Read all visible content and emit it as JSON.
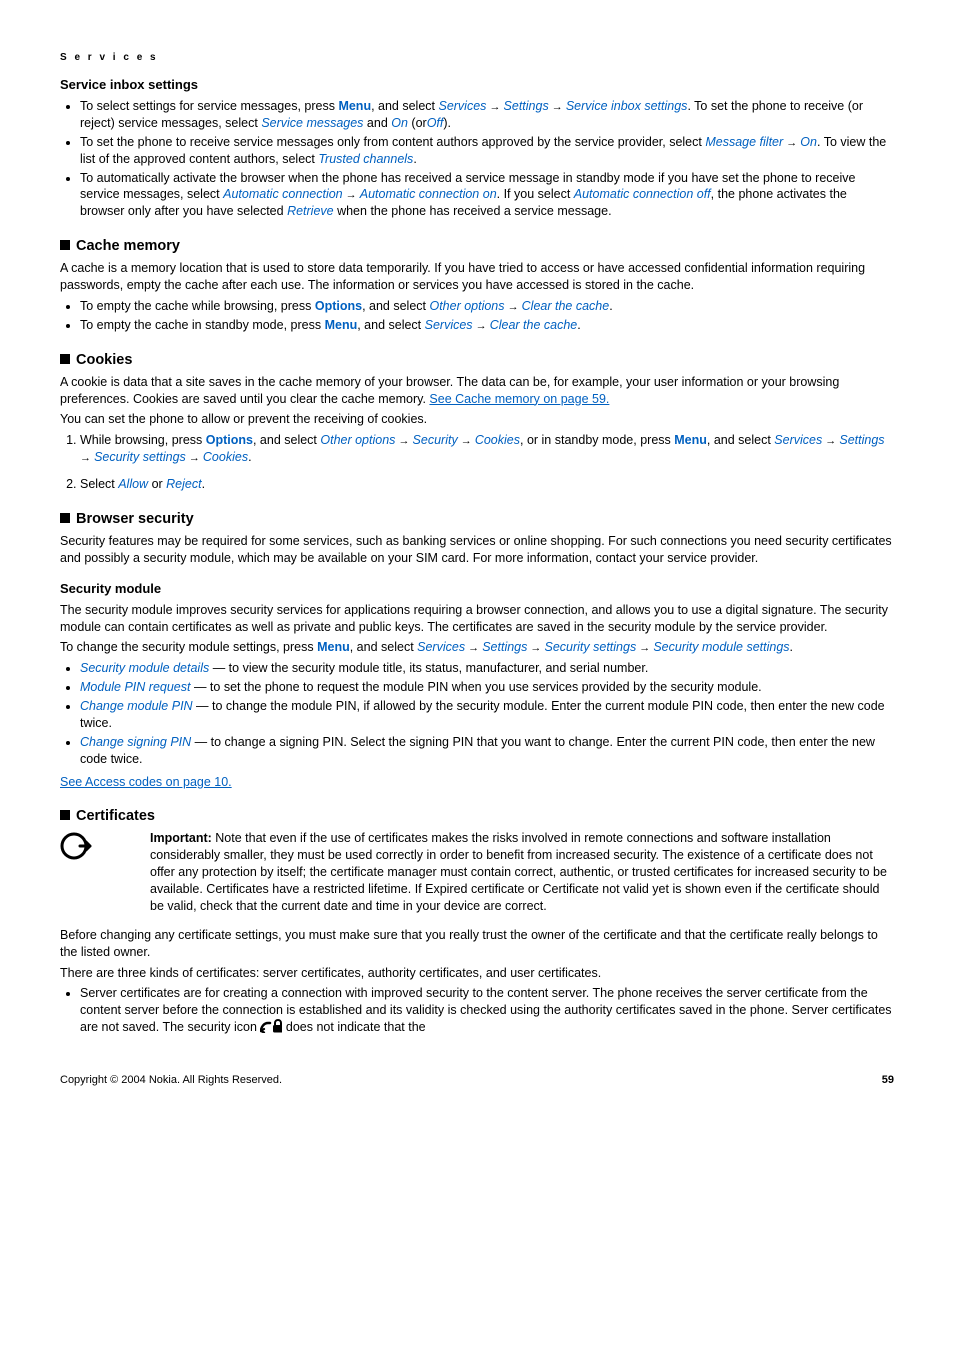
{
  "page": {
    "chapter": "S e r v i c e s",
    "copyright": "Copyright © 2004 Nokia. All Rights Reserved.",
    "number": "59"
  },
  "inbox": {
    "heading": "Service inbox settings",
    "b1_a": "To select settings for service messages, press ",
    "b1_menu": "Menu",
    "b1_b": ", and select ",
    "b1_services": "Services",
    "b1_c": "  →  ",
    "b1_settings": "Settings",
    "b1_d": "  →  ",
    "b1_sis": "Service inbox settings",
    "b1_e": ". To set the phone to receive (or reject) service messages, select ",
    "b1_sm": "Service messages",
    "b1_f": " and ",
    "b1_on": "On",
    "b1_g": " (or",
    "b1_off": "Off",
    "b1_h": ").",
    "b2_a": "To set the phone to receive service messages only from content authors approved by the service provider, select ",
    "b2_mf": "Message filter",
    "b2_b": "  →  ",
    "b2_on": "On",
    "b2_c": ". To view the list of the approved content authors, select ",
    "b2_tc": "Trusted channels",
    "b2_d": ".",
    "b3_a": "To automatically activate the browser when the phone has received a service message in standby mode if you have set the phone to receive service messages, select ",
    "b3_ac": "Automatic connection",
    "b3_b": "  →  ",
    "b3_aco": "Automatic connection on",
    "b3_c": ". If you select ",
    "b3_acoff": "Automatic connection off",
    "b3_d": ", the phone activates the browser only after you have selected ",
    "b3_ret": "Retrieve",
    "b3_e": " when the phone has received a service message."
  },
  "cache": {
    "heading": "Cache memory",
    "p1": "A cache is a memory location that is used to store data temporarily. If you have tried to access or have accessed confidential information requiring passwords, empty the cache after each use. The information or services you have accessed is stored in the cache.",
    "b1_a": "To empty the cache while browsing, press ",
    "b1_opt": "Options",
    "b1_b": ", and select ",
    "b1_oo": "Other options",
    "b1_c": "  →  ",
    "b1_ctc": "Clear the cache",
    "b1_d": ".",
    "b2_a": "To empty the cache in standby mode, press ",
    "b2_menu": "Menu",
    "b2_b": ", and select ",
    "b2_srv": "Services",
    "b2_c": "  →  ",
    "b2_ctc": "Clear the cache",
    "b2_d": "."
  },
  "cookies": {
    "heading": "Cookies",
    "p1_a": "A cookie is data that a site saves in the cache memory of your browser. The data can be, for example, your user information or your browsing preferences. Cookies are saved until you clear the cache memory. ",
    "p1_link": "See Cache memory on page 59.",
    "p2": "You can set the phone to allow or prevent the receiving of cookies.",
    "s1_a": "While browsing, press ",
    "s1_opt": "Options",
    "s1_b": ", and select ",
    "s1_oo": "Other options",
    "s1_c": "  →  ",
    "s1_sec": "Security",
    "s1_d": "  →  ",
    "s1_ck": "Cookies",
    "s1_e": ", or in standby mode, press ",
    "s1_menu": "Menu",
    "s1_f": ", and select ",
    "s1_srv": "Services",
    "s1_g": "  →  ",
    "s1_set": "Settings",
    "s1_h": "  →  ",
    "s1_ss": "Security settings",
    "s1_i": "  →  ",
    "s1_ck2": "Cookies",
    "s1_j": ".",
    "s2_a": "Select ",
    "s2_allow": "Allow",
    "s2_b": " or ",
    "s2_reject": "Reject",
    "s2_c": "."
  },
  "bsec": {
    "heading": "Browser security",
    "p1": "Security features may be required for some services, such as banking services or online shopping. For such connections you need security certificates and possibly a security module, which may be available on your SIM card. For more information, contact your service provider."
  },
  "secmod": {
    "heading": "Security module",
    "p1": "The security module improves security services for applications requiring a browser connection, and allows you to use a digital signature. The security module can contain certificates as well as private and public keys. The certificates are saved in the security module by the service provider.",
    "p2_a": "To change the security module settings, press ",
    "p2_menu": "Menu",
    "p2_b": ", and select ",
    "p2_srv": "Services",
    "p2_c": "  →  ",
    "p2_set": "Settings",
    "p2_d": "  →  ",
    "p2_ss": "Security settings",
    "p2_e": "  →  ",
    "p2_sms": "Security module settings",
    "p2_f": ".",
    "b1_t": "Security module details",
    "b1_d": " — to view the security module title, its status, manufacturer, and serial number.",
    "b2_t": "Module PIN request",
    "b2_d": " — to set the phone to request the module PIN when you use services provided by the security module.",
    "b3_t": "Change module PIN",
    "b3_d": " — to change the module PIN, if allowed by the security module. Enter the current module PIN code, then enter the new code twice.",
    "b4_t": "Change signing PIN",
    "b4_d": " — to change a signing PIN. Select the signing PIN that you want to change. Enter the current PIN code, then enter the new code twice.",
    "link": "See Access codes on page 10."
  },
  "certs": {
    "heading": "Certificates",
    "imp_lead": "Important:  ",
    "imp_body": "Note that even if the use of certificates makes the risks involved in remote connections and software installation considerably smaller, they must be used correctly in order to benefit from increased security. The existence of a certificate does not offer any protection by itself; the certificate manager must contain correct, authentic, or trusted certificates for increased security to be available. Certificates have a restricted lifetime. If Expired certificate or Certificate not valid yet is shown even if the certificate should be valid, check that the current date and time in your device are correct.",
    "p1": "Before changing any certificate settings, you must make sure that you really trust the owner of the certificate and that the certificate really belongs to the listed owner.",
    "p2": "There are three kinds of certificates: server certificates, authority certificates, and user certificates.",
    "b1_a": "Server certificates are for creating a connection with improved security to the content server. The phone receives the server certificate from the content server before the connection is established and its validity is checked using the authority certificates saved in the phone. Server certificates are not saved. The security icon ",
    "b1_b": " does not indicate that the"
  }
}
